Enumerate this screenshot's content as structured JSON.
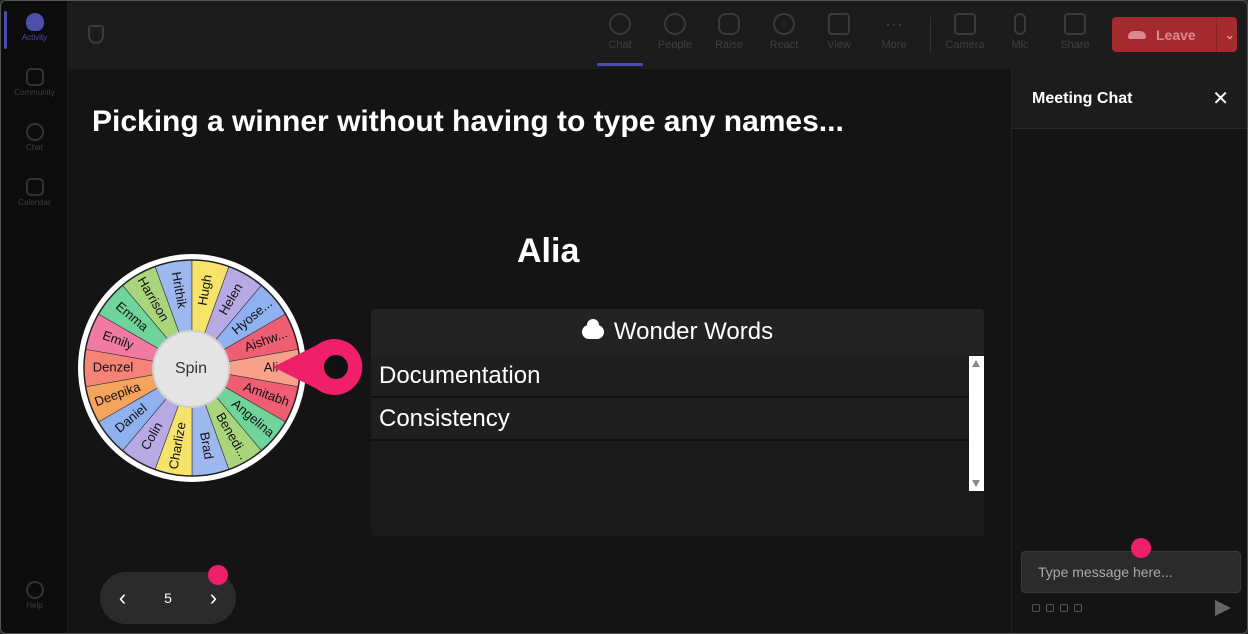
{
  "rail": {
    "items": [
      {
        "label": "Activity"
      },
      {
        "label": "Community"
      },
      {
        "label": "Chat"
      },
      {
        "label": "Calendar"
      },
      {
        "label": "Help"
      }
    ]
  },
  "toolbar": {
    "chat": "Chat",
    "people": "People",
    "raise": "Raise",
    "react": "React",
    "view": "View",
    "more": "More",
    "camera": "Camera",
    "mic": "Mic",
    "share": "Share",
    "leave": "Leave"
  },
  "stage": {
    "title": "Picking a winner without having to type any names...",
    "winner": "Alia",
    "spin_label": "Spin"
  },
  "wheel": {
    "names": [
      "Ali",
      "Amitabh",
      "Angelina",
      "Benedi...",
      "Brad",
      "Charlize",
      "Colin",
      "Daniel",
      "Deepika",
      "Denzel",
      "Emily",
      "Emma",
      "Harrison",
      "Hrithik",
      "Hugh",
      "Helen",
      "Hyose...",
      "Aishw..."
    ],
    "colors": [
      "#f7a08a",
      "#f05e73",
      "#6fd39a",
      "#a9d67c",
      "#9db7ef",
      "#f7e36a",
      "#b7a9e3",
      "#8fb1ef",
      "#f5a45e",
      "#f58476",
      "#f07aa3",
      "#6fd39a",
      "#a9d67c",
      "#9db7ef",
      "#f7e36a",
      "#b7a9e3",
      "#8fb1ef",
      "#f05e73"
    ],
    "pointer_color": "#ef1f6a"
  },
  "wonder_words": {
    "header": "Wonder Words",
    "items": [
      "Documentation",
      "Consistency"
    ]
  },
  "pager": {
    "page": "5"
  },
  "chat": {
    "title": "Meeting Chat",
    "placeholder": "Type message here..."
  }
}
